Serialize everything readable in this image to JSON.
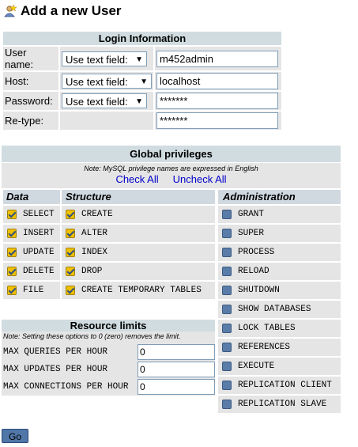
{
  "title": "Add a new User",
  "login": {
    "caption": "Login Information",
    "rows": [
      {
        "label": "User name:",
        "select": "Use text field:",
        "value": "m452admin"
      },
      {
        "label": "Host:",
        "select": "Use text field:",
        "value": "localhost"
      },
      {
        "label": "Password:",
        "select": "Use text field:",
        "value": "*******"
      },
      {
        "label": "Re-type:",
        "value": "*******"
      }
    ]
  },
  "privileges": {
    "caption": "Global privileges",
    "note": "Note: MySQL privilege names are expressed in English",
    "check_all": "Check All",
    "uncheck_all": "Uncheck All",
    "columns": {
      "data": "Data",
      "structure": "Structure",
      "administration": "Administration"
    },
    "data": [
      {
        "name": "SELECT",
        "checked": true
      },
      {
        "name": "INSERT",
        "checked": true
      },
      {
        "name": "UPDATE",
        "checked": true
      },
      {
        "name": "DELETE",
        "checked": true
      },
      {
        "name": "FILE",
        "checked": true
      }
    ],
    "structure": [
      {
        "name": "CREATE",
        "checked": true
      },
      {
        "name": "ALTER",
        "checked": true
      },
      {
        "name": "INDEX",
        "checked": true
      },
      {
        "name": "DROP",
        "checked": true
      },
      {
        "name": "CREATE TEMPORARY TABLES",
        "checked": true
      }
    ],
    "administration": [
      {
        "name": "GRANT",
        "checked": false
      },
      {
        "name": "SUPER",
        "checked": false
      },
      {
        "name": "PROCESS",
        "checked": false
      },
      {
        "name": "RELOAD",
        "checked": false
      },
      {
        "name": "SHUTDOWN",
        "checked": false
      },
      {
        "name": "SHOW DATABASES",
        "checked": false
      },
      {
        "name": "LOCK TABLES",
        "checked": false
      },
      {
        "name": "REFERENCES",
        "checked": false
      },
      {
        "name": "EXECUTE",
        "checked": false
      },
      {
        "name": "REPLICATION CLIENT",
        "checked": false
      },
      {
        "name": "REPLICATION SLAVE",
        "checked": false
      }
    ]
  },
  "resource_limits": {
    "caption": "Resource limits",
    "note": "Note: Setting these options to 0 (zero) removes the limit.",
    "rows": [
      {
        "label": "MAX QUERIES PER HOUR",
        "value": "0"
      },
      {
        "label": "MAX UPDATES PER HOUR",
        "value": "0"
      },
      {
        "label": "MAX CONNECTIONS PER HOUR",
        "value": "0"
      }
    ]
  },
  "go_label": "Go",
  "icons": {
    "title": "add-user-icon",
    "checked": "checkbox-checked-icon",
    "unchecked": "checkbox-unchecked-icon"
  },
  "colors": {
    "header": "#d0dce0",
    "cell": "#e5e5e5",
    "link": "#0000cc",
    "button": "#5077a8"
  }
}
